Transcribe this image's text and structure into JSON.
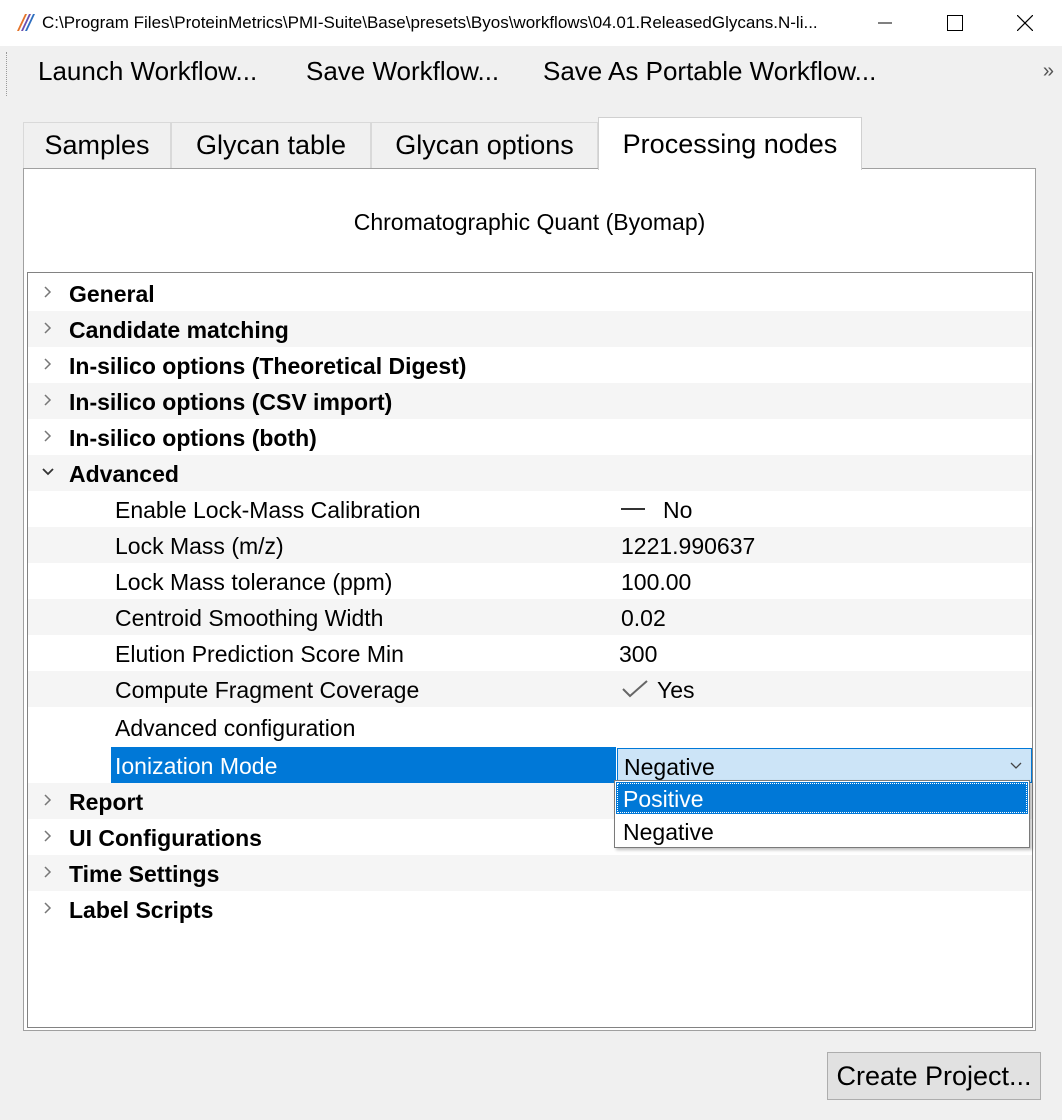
{
  "window": {
    "title": "C:\\Program Files\\ProteinMetrics\\PMI-Suite\\Base\\presets\\Byos\\workflows\\04.01.ReleasedGlycans.N-li...",
    "minimize_icon": "minimize-icon",
    "maximize_icon": "maximize-icon",
    "close_icon": "close-icon"
  },
  "toolbar": {
    "launch_label": "Launch Workflow...",
    "save_label": "Save Workflow...",
    "save_portable_label": "Save As Portable Workflow...",
    "overflow_label": "»"
  },
  "tabs": [
    {
      "label": "Samples",
      "active": false
    },
    {
      "label": "Glycan table",
      "active": false
    },
    {
      "label": "Glycan options",
      "active": false
    },
    {
      "label": "Processing nodes",
      "active": true
    }
  ],
  "node": {
    "title": "Chromatographic Quant (Byomap)"
  },
  "tree": {
    "groups_before": [
      {
        "label": "General",
        "expanded": false
      },
      {
        "label": "Candidate matching",
        "expanded": false
      },
      {
        "label": "In-silico options (Theoretical Digest)",
        "expanded": false
      },
      {
        "label": "In-silico options (CSV import)",
        "expanded": false
      },
      {
        "label": "In-silico options (both)",
        "expanded": false
      }
    ],
    "advanced": {
      "label": "Advanced",
      "expanded": true,
      "properties": [
        {
          "label": "Enable Lock-Mass Calibration",
          "value": "No",
          "icon": "dash-icon"
        },
        {
          "label": "Lock Mass (m/z)",
          "value": "1221.990637"
        },
        {
          "label": "Lock Mass tolerance (ppm)",
          "value": "100.00"
        },
        {
          "label": "Centroid Smoothing Width",
          "value": "0.02"
        },
        {
          "label": "Elution Prediction Score Min",
          "value": "300"
        },
        {
          "label": "Compute Fragment Coverage",
          "value": "Yes",
          "icon": "checkmark-icon"
        },
        {
          "label": "Advanced configuration",
          "value": ""
        },
        {
          "label": "Ionization Mode",
          "value": "Negative",
          "selected": true
        }
      ]
    },
    "groups_after": [
      {
        "label": "Report",
        "expanded": false
      },
      {
        "label": "UI Configurations",
        "expanded": false
      },
      {
        "label": "Time Settings",
        "expanded": false
      },
      {
        "label": "Label Scripts",
        "expanded": false
      }
    ]
  },
  "ionization_dropdown": {
    "options": [
      "Positive",
      "Negative"
    ],
    "highlighted": "Positive",
    "selected": "Negative"
  },
  "footer": {
    "create_label": "Create Project..."
  },
  "colors": {
    "selection": "#0078d7",
    "combo_bg": "#cce4f7",
    "window_bg": "#f0f0f0"
  }
}
